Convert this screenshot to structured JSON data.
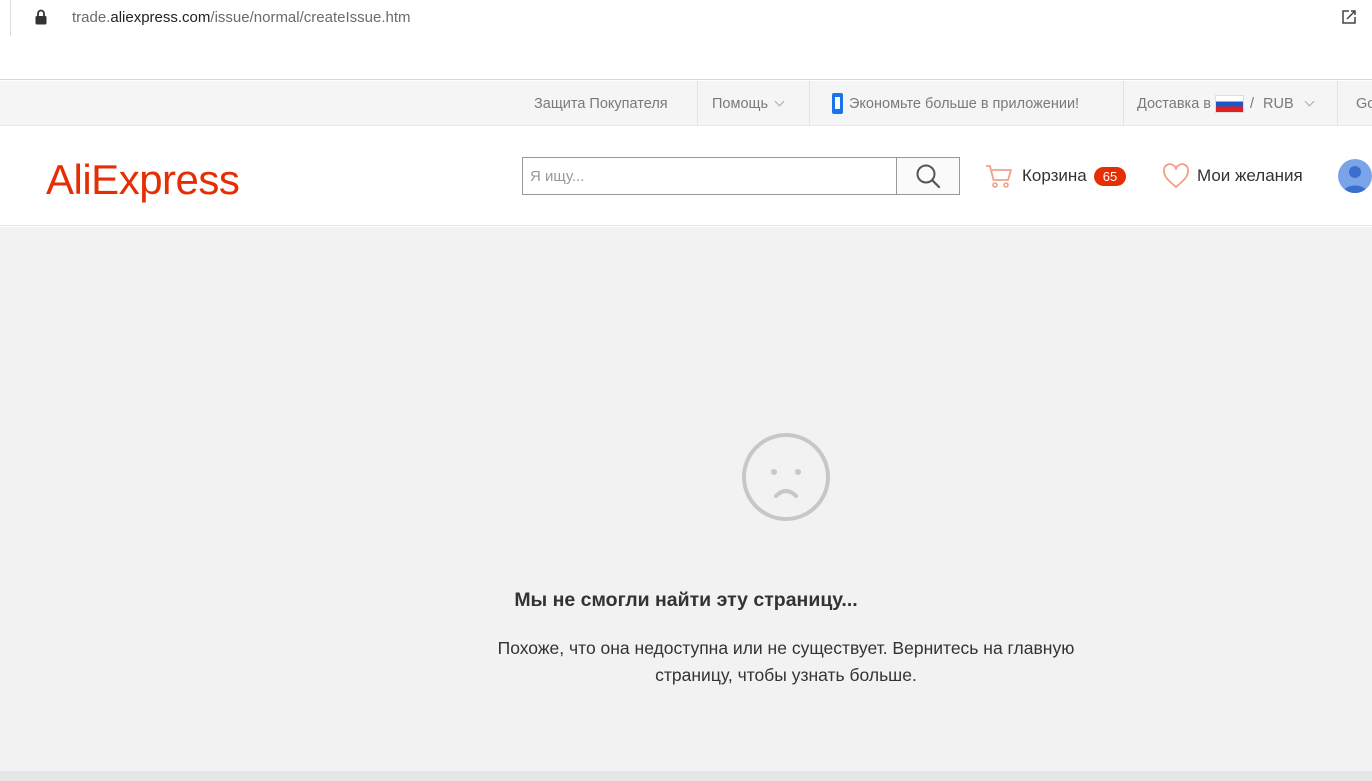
{
  "browser": {
    "url_prefix": "trade.",
    "url_domain": "aliexpress.com",
    "url_path": "/issue/normal/createIssue.htm"
  },
  "topbar": {
    "buyer_protection": "Защита Покупателя",
    "help": "Помощь",
    "app_promo": "Экономьте больше в приложении!",
    "delivery_label": "Доставка в",
    "currency_sep": "/",
    "currency": "RUB",
    "language_partial": "Go"
  },
  "header": {
    "logo": "AliExpress",
    "search_placeholder": "Я ищу...",
    "cart_label": "Корзина",
    "cart_count": "65",
    "wishlist_label": "Мои желания"
  },
  "error": {
    "title": "Мы не смогли найти эту страницу...",
    "description": "Похоже, что она недоступна или не существует. Вернитесь на главную страницу, чтобы узнать больше."
  },
  "colors": {
    "brand": "#e62e04",
    "background": "#f2f2f2"
  }
}
